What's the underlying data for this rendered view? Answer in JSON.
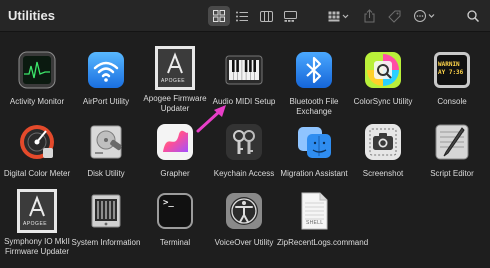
{
  "window": {
    "title": "Utilities"
  },
  "toolbar": {
    "view_icons": "icon-view-icon",
    "view_list": "list-view-icon",
    "view_columns": "column-view-icon",
    "view_gallery": "gallery-view-icon",
    "group": "group-icon",
    "share": "share-icon",
    "tag": "tag-icon",
    "more": "more-icon",
    "search": "search-icon"
  },
  "apps": [
    {
      "name": "Activity Monitor"
    },
    {
      "name": "AirPort Utility"
    },
    {
      "name": "Apogee Firmware Updater",
      "badge": "APOGEE"
    },
    {
      "name": "Audio MIDI Setup"
    },
    {
      "name": "Bluetooth File Exchange"
    },
    {
      "name": "ColorSync Utility"
    },
    {
      "name": "Console",
      "screen_text": [
        "WARNIN",
        "AY 7:36"
      ]
    },
    {
      "name": "Digital Color Meter"
    },
    {
      "name": "Disk Utility"
    },
    {
      "name": "Grapher"
    },
    {
      "name": "Keychain Access"
    },
    {
      "name": "Migration Assistant"
    },
    {
      "name": "Screenshot"
    },
    {
      "name": "Script Editor"
    },
    {
      "name": "Symphony IO MkII Firmware Updater",
      "badge": "APOGEE"
    },
    {
      "name": "System Information"
    },
    {
      "name": "Terminal",
      "screen_text": [
        ">_"
      ]
    },
    {
      "name": "VoiceOver Utility"
    },
    {
      "name": "ZipRecentLogs.command",
      "doc_label": "SHELL"
    }
  ],
  "annotation": {
    "color": "#e83ec8"
  },
  "colors": {
    "background": "#1e1e1e",
    "toolbar": "#262626",
    "accent": "#e83ec8"
  }
}
